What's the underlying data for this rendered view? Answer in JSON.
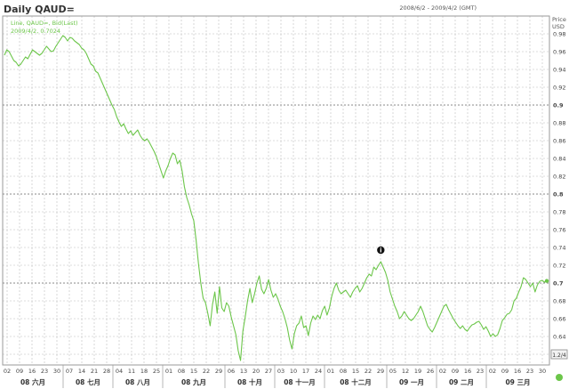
{
  "header": {
    "title": "Daily QAUD=",
    "date_range": "2008/6/2 - 2009/4/2 (GMT)"
  },
  "legend": {
    "line1": "Line, QAUD=, Bid(Last)",
    "line2": "2009/4/2, 0.7024"
  },
  "axis": {
    "y_title_1": "Price",
    "y_title_2": "USD",
    "scale_box": "1.2/4"
  },
  "annotation": {
    "event_marker": "i"
  },
  "colors": {
    "series": "#6cc64a",
    "grid": "#bdbdbd",
    "text": "#333333"
  },
  "chart_data": {
    "type": "line",
    "title": "Daily QAUD=",
    "xlabel": "",
    "ylabel": "Price USD",
    "ylim": [
      0.608,
      1.0
    ],
    "y_ticks": [
      0.62,
      0.64,
      0.66,
      0.68,
      0.7,
      0.72,
      0.74,
      0.76,
      0.78,
      0.8,
      0.82,
      0.84,
      0.86,
      0.88,
      0.9,
      0.92,
      0.94,
      0.96,
      0.98
    ],
    "y_tick_labels": [
      "0.62",
      "0.64",
      "0.66",
      "0.68",
      "0.7",
      "0.72",
      "0.74",
      "0.76",
      "0.78",
      "0.8",
      "0.82",
      "0.84",
      "0.86",
      "0.88",
      "0.9",
      "0.92",
      "0.94",
      "0.96",
      "0.98"
    ],
    "y_tick_major": [
      0.7,
      0.8,
      0.9
    ],
    "x_day_ticks": [
      "02",
      "09",
      "16",
      "23",
      "30",
      "07",
      "14",
      "21",
      "28",
      "04",
      "11",
      "18",
      "25",
      "01",
      "08",
      "15",
      "22",
      "29",
      "06",
      "13",
      "20",
      "27",
      "03",
      "10",
      "17",
      "24",
      "01",
      "08",
      "15",
      "22",
      "29",
      "05",
      "12",
      "19",
      "26",
      "02",
      "09",
      "16",
      "23",
      "02",
      "09",
      "16",
      "23",
      "30"
    ],
    "x_month_labels": [
      "08 六月",
      "08 七月",
      "08 八月",
      "08 九月",
      "08 十月",
      "08 十一月",
      "08 十二月",
      "09 一月",
      "09 二月",
      "09 三月"
    ],
    "x_month_start_index": [
      0,
      5,
      9,
      13,
      18,
      22,
      26,
      31,
      35,
      39
    ],
    "grid": true,
    "series": [
      {
        "name": "QAUD=",
        "values": [
          0.956,
          0.962,
          0.96,
          0.955,
          0.95,
          0.948,
          0.944,
          0.946,
          0.95,
          0.954,
          0.952,
          0.957,
          0.962,
          0.96,
          0.958,
          0.956,
          0.958,
          0.962,
          0.966,
          0.963,
          0.96,
          0.961,
          0.966,
          0.97,
          0.974,
          0.978,
          0.976,
          0.972,
          0.976,
          0.975,
          0.972,
          0.97,
          0.968,
          0.964,
          0.962,
          0.958,
          0.952,
          0.946,
          0.944,
          0.938,
          0.936,
          0.93,
          0.924,
          0.918,
          0.912,
          0.906,
          0.9,
          0.895,
          0.887,
          0.881,
          0.876,
          0.879,
          0.873,
          0.868,
          0.871,
          0.866,
          0.869,
          0.872,
          0.866,
          0.862,
          0.86,
          0.862,
          0.858,
          0.853,
          0.848,
          0.842,
          0.834,
          0.826,
          0.818,
          0.826,
          0.832,
          0.84,
          0.846,
          0.844,
          0.834,
          0.838,
          0.826,
          0.808,
          0.796,
          0.788,
          0.778,
          0.77,
          0.748,
          0.722,
          0.7,
          0.683,
          0.678,
          0.666,
          0.652,
          0.676,
          0.69,
          0.666,
          0.696,
          0.672,
          0.668,
          0.678,
          0.674,
          0.662,
          0.652,
          0.642,
          0.624,
          0.613,
          0.646,
          0.662,
          0.68,
          0.694,
          0.678,
          0.688,
          0.7,
          0.708,
          0.693,
          0.688,
          0.694,
          0.704,
          0.692,
          0.684,
          0.688,
          0.682,
          0.674,
          0.668,
          0.66,
          0.65,
          0.636,
          0.626,
          0.643,
          0.652,
          0.655,
          0.663,
          0.65,
          0.652,
          0.641,
          0.655,
          0.663,
          0.659,
          0.664,
          0.66,
          0.669,
          0.674,
          0.664,
          0.672,
          0.685,
          0.694,
          0.7,
          0.692,
          0.688,
          0.69,
          0.692,
          0.688,
          0.684,
          0.69,
          0.694,
          0.697,
          0.69,
          0.694,
          0.7,
          0.706,
          0.71,
          0.708,
          0.718,
          0.715,
          0.72,
          0.724,
          0.718,
          0.712,
          0.703,
          0.69,
          0.682,
          0.674,
          0.668,
          0.66,
          0.663,
          0.668,
          0.664,
          0.66,
          0.658,
          0.66,
          0.664,
          0.668,
          0.674,
          0.668,
          0.66,
          0.652,
          0.648,
          0.645,
          0.65,
          0.656,
          0.662,
          0.668,
          0.674,
          0.676,
          0.67,
          0.665,
          0.66,
          0.656,
          0.652,
          0.649,
          0.652,
          0.648,
          0.646,
          0.65,
          0.653,
          0.654,
          0.656,
          0.657,
          0.653,
          0.648,
          0.651,
          0.646,
          0.64,
          0.643,
          0.64,
          0.642,
          0.649,
          0.658,
          0.661,
          0.665,
          0.666,
          0.67,
          0.68,
          0.683,
          0.69,
          0.696,
          0.706,
          0.704,
          0.7,
          0.696,
          0.7,
          0.69,
          0.698,
          0.702,
          0.703,
          0.701,
          0.7024
        ]
      }
    ]
  }
}
